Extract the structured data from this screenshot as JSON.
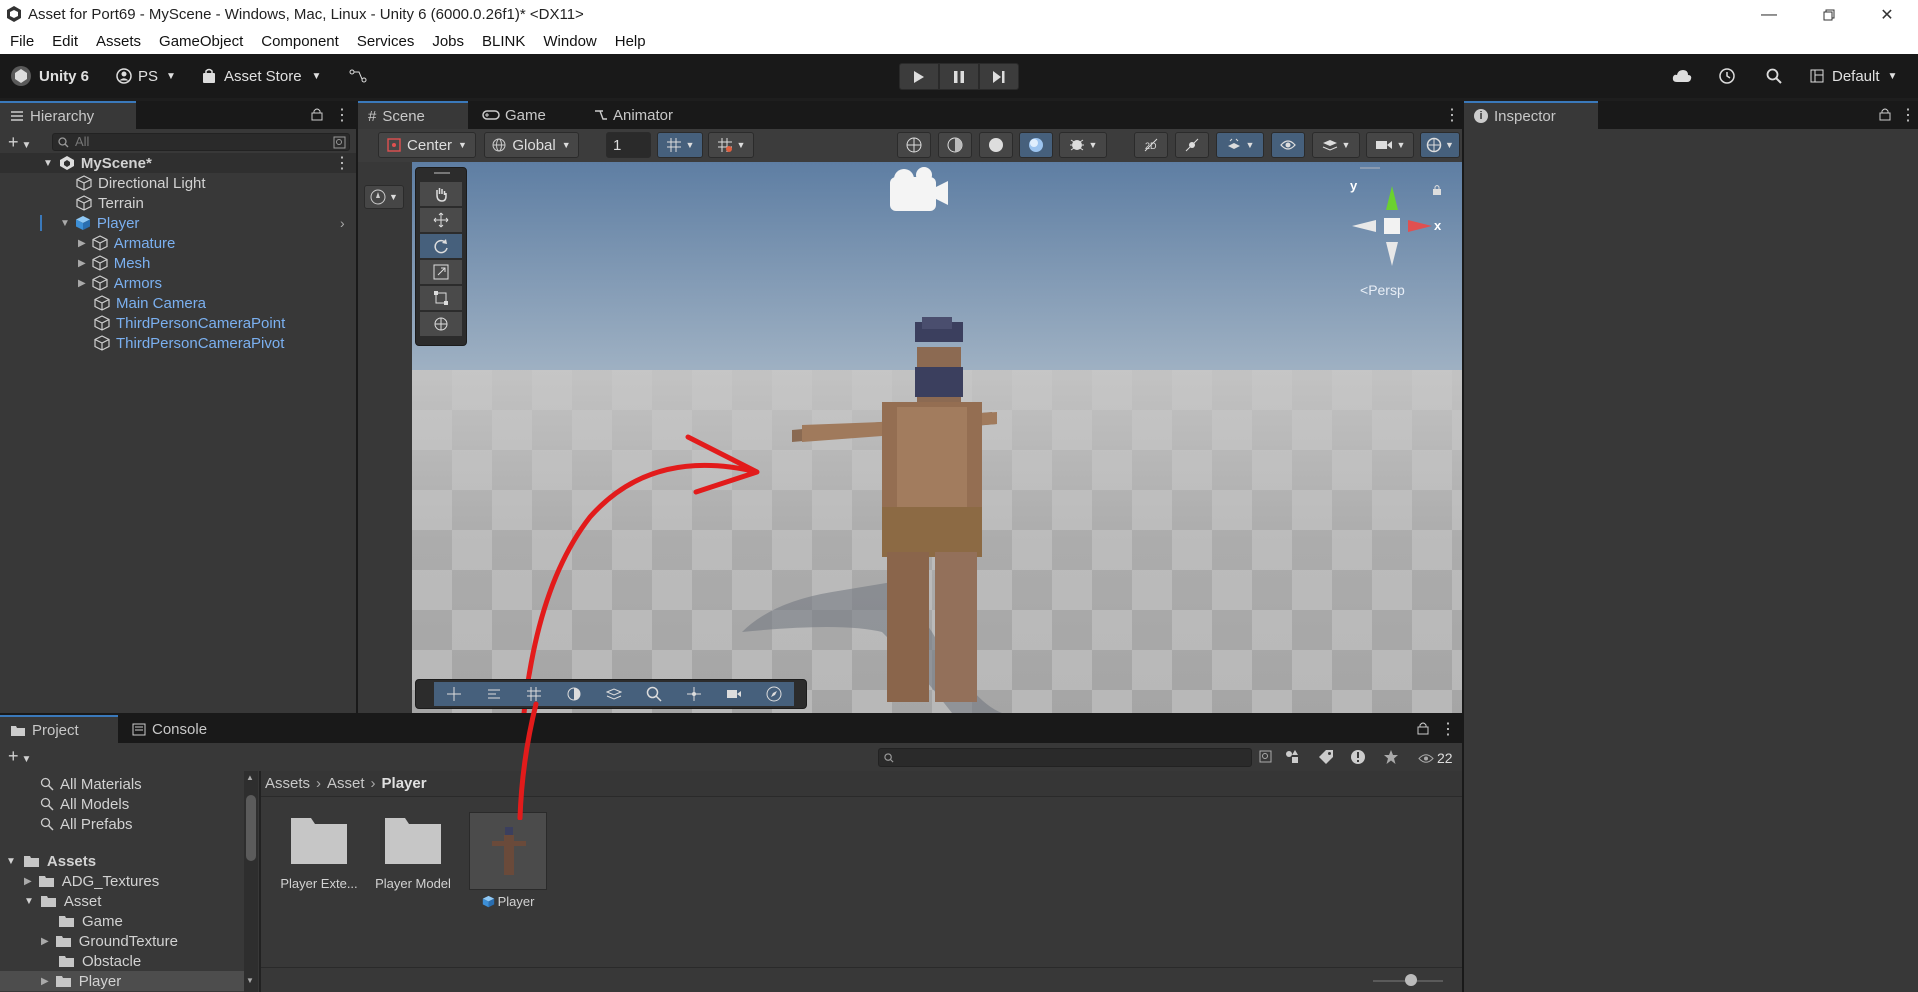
{
  "window": {
    "title": "Asset for Port69 - MyScene - Windows, Mac, Linux - Unity 6 (6000.0.26f1)* <DX11>"
  },
  "menu": [
    "File",
    "Edit",
    "Assets",
    "GameObject",
    "Component",
    "Services",
    "Jobs",
    "BLINK",
    "Window",
    "Help"
  ],
  "toolbar": {
    "unity_label": "Unity 6",
    "account_label": "PS",
    "asset_store_label": "Asset Store",
    "layout_label": "Default"
  },
  "hierarchy": {
    "tab_label": "Hierarchy",
    "search_placeholder": "All",
    "scene_name": "MyScene*",
    "items": [
      {
        "label": "Directional Light"
      },
      {
        "label": "Terrain"
      },
      {
        "label": "Player"
      },
      {
        "label": "Armature"
      },
      {
        "label": "Mesh"
      },
      {
        "label": "Armors"
      },
      {
        "label": "Main Camera"
      },
      {
        "label": "ThirdPersonCameraPoint"
      },
      {
        "label": "ThirdPersonCameraPivot"
      }
    ]
  },
  "scene_view": {
    "tabs": [
      "Scene",
      "Game",
      "Animator"
    ],
    "pivot_mode": "Center",
    "pivot_rotation": "Global",
    "grid_size": "1",
    "persp_label": "Persp",
    "axis_y": "y",
    "axis_x": "x"
  },
  "inspector": {
    "tab_label": "Inspector"
  },
  "project": {
    "tabs": [
      "Project",
      "Console"
    ],
    "hidden_count": "22",
    "favorites": [
      "All Materials",
      "All Models",
      "All Prefabs"
    ],
    "assets_root": "Assets",
    "tree": [
      {
        "label": "ADG_Textures"
      },
      {
        "label": "Asset"
      },
      {
        "label": "Game"
      },
      {
        "label": "GroundTexture"
      },
      {
        "label": "Obstacle"
      },
      {
        "label": "Player"
      }
    ],
    "breadcrumb": [
      "Assets",
      "Asset",
      "Player"
    ],
    "files": [
      {
        "label": "Player Exte..."
      },
      {
        "label": "Player Model"
      },
      {
        "label": "Player"
      }
    ]
  },
  "colors": {
    "accent": "#3a79bb",
    "panel_bg": "#383838",
    "highlight_text": "#7bb0f0",
    "annotation_arrow": "#e21b1b"
  }
}
